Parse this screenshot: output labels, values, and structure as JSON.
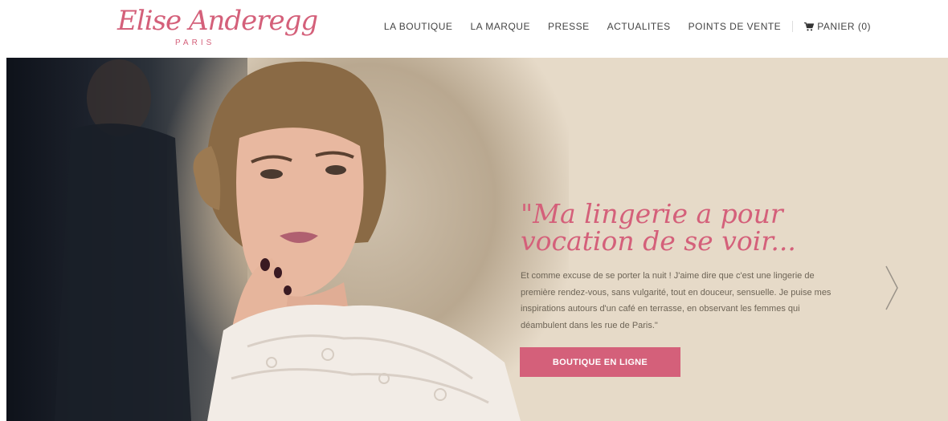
{
  "brand": {
    "name": "Elise Anderegg",
    "sub": "PARIS",
    "color": "#d4607a"
  },
  "nav": {
    "items": [
      "LA BOUTIQUE",
      "LA MARQUE",
      "PRESSE",
      "ACTUALITES",
      "POINTS DE VENTE"
    ],
    "cart_label": "PANIER (0)",
    "cart_icon": "cart-icon"
  },
  "hero": {
    "title_line1": "\"Ma lingerie a pour",
    "title_line2": "vocation de se voir...",
    "body": "Et comme excuse de se porter la nuit ! J'aime dire que c'est une lingerie de première rendez-vous, sans vulgarité, tout en douceur, sensuelle. Je puise mes inspirations autours d'un café en terrasse, en observant les femmes qui déambulent dans les rue de Paris.\"",
    "cta_label": "BOUTIQUE EN LIGNE",
    "next_icon": "chevron-right-icon",
    "accent": "#d4607a",
    "background": "#e6dac8"
  }
}
